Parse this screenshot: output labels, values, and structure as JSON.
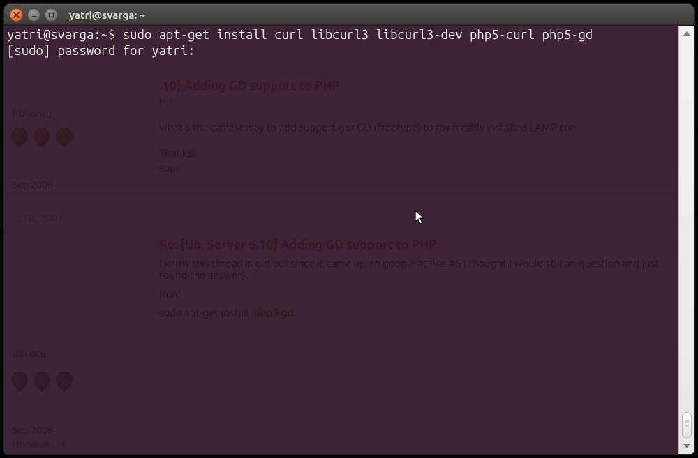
{
  "window": {
    "title": "yatri@svarga: ~"
  },
  "terminal": {
    "line1_prefix": "yatri@svarga:~$ ",
    "line1_cmd": "sudo apt-get install curl libcurl3 libcurl3-dev php5-curl php5-gd",
    "line2": "[sudo] password for yatri:"
  },
  "background": {
    "post1": {
      "title_suffix": ".10] Adding GD support to PHP",
      "hi": "Hi!",
      "body": "what's the easiest way to add support gor GD (freetype) to my freshly installed LAMP con",
      "thanks": "Thanks!",
      "sig": "supr",
      "distro": "f Ubuntu",
      "joined": "Sep 2006"
    },
    "divider_date": "31st, 2007",
    "post2": {
      "title": "Re: [Ub. Server 6.10] Adding GD support to PHP",
      "body": "I know this thread is old but since it came up on google at like #5 I thought I would still an question and just found the answer).",
      "run": "Run:",
      "cmd_prefix": "sudo apt-get install ",
      "cmd_hl": "php5-gd",
      "distro": "Ubuntu",
      "joined": "Sep 2006",
      "loc": "Honolulu, HI"
    }
  }
}
